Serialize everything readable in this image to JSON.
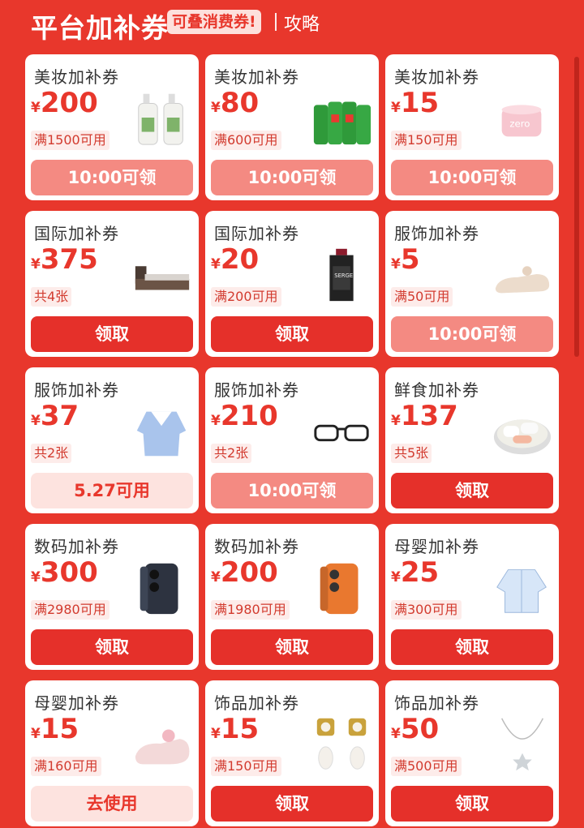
{
  "header": {
    "title": "平台加补券",
    "badge": "可叠消费券!",
    "guide": "攻略"
  },
  "currency": "¥",
  "cards": [
    {
      "category": "美妆加补券",
      "amount": "200",
      "condition": "满1500可用",
      "button": "10:00可领",
      "button_style": "pink",
      "icon": "lotion-bottles-icon"
    },
    {
      "category": "美妆加补券",
      "amount": "80",
      "condition": "满600可用",
      "button": "10:00可领",
      "button_style": "pink",
      "icon": "detergent-bottles-icon"
    },
    {
      "category": "美妆加补券",
      "amount": "15",
      "condition": "满150可用",
      "button": "10:00可领",
      "button_style": "pink",
      "icon": "cream-jar-icon"
    },
    {
      "category": "国际加补券",
      "amount": "375",
      "condition": "共4张",
      "button": "领取",
      "button_style": "red",
      "icon": "bed-icon"
    },
    {
      "category": "国际加补券",
      "amount": "20",
      "condition": "满200可用",
      "button": "领取",
      "button_style": "red",
      "icon": "perfume-bottle-icon"
    },
    {
      "category": "服饰加补券",
      "amount": "5",
      "condition": "满50可用",
      "button": "10:00可领",
      "button_style": "pink",
      "icon": "flat-shoe-icon"
    },
    {
      "category": "服饰加补券",
      "amount": "37",
      "condition": "共2张",
      "button": "5.27可用",
      "button_style": "light",
      "icon": "sailor-top-icon"
    },
    {
      "category": "服饰加补券",
      "amount": "210",
      "condition": "共2张",
      "button": "10:00可领",
      "button_style": "pink",
      "icon": "eyeglasses-icon"
    },
    {
      "category": "鲜食加补券",
      "amount": "137",
      "condition": "共5张",
      "button": "领取",
      "button_style": "red",
      "icon": "food-bowl-icon"
    },
    {
      "category": "数码加补券",
      "amount": "300",
      "condition": "满2980可用",
      "button": "领取",
      "button_style": "red",
      "icon": "dark-phone-icon"
    },
    {
      "category": "数码加补券",
      "amount": "200",
      "condition": "满1980可用",
      "button": "领取",
      "button_style": "red",
      "icon": "orange-phone-icon"
    },
    {
      "category": "母婴加补券",
      "amount": "25",
      "condition": "满300可用",
      "button": "领取",
      "button_style": "red",
      "icon": "baby-jacket-icon"
    },
    {
      "category": "母婴加补券",
      "amount": "15",
      "condition": "满160可用",
      "button": "去使用",
      "button_style": "light",
      "icon": "baby-sandal-icon"
    },
    {
      "category": "饰品加补券",
      "amount": "15",
      "condition": "满150可用",
      "button": "领取",
      "button_style": "red",
      "icon": "pearl-earrings-icon"
    },
    {
      "category": "饰品加补券",
      "amount": "50",
      "condition": "满500可用",
      "button": "领取",
      "button_style": "red",
      "icon": "star-necklace-icon"
    }
  ]
}
